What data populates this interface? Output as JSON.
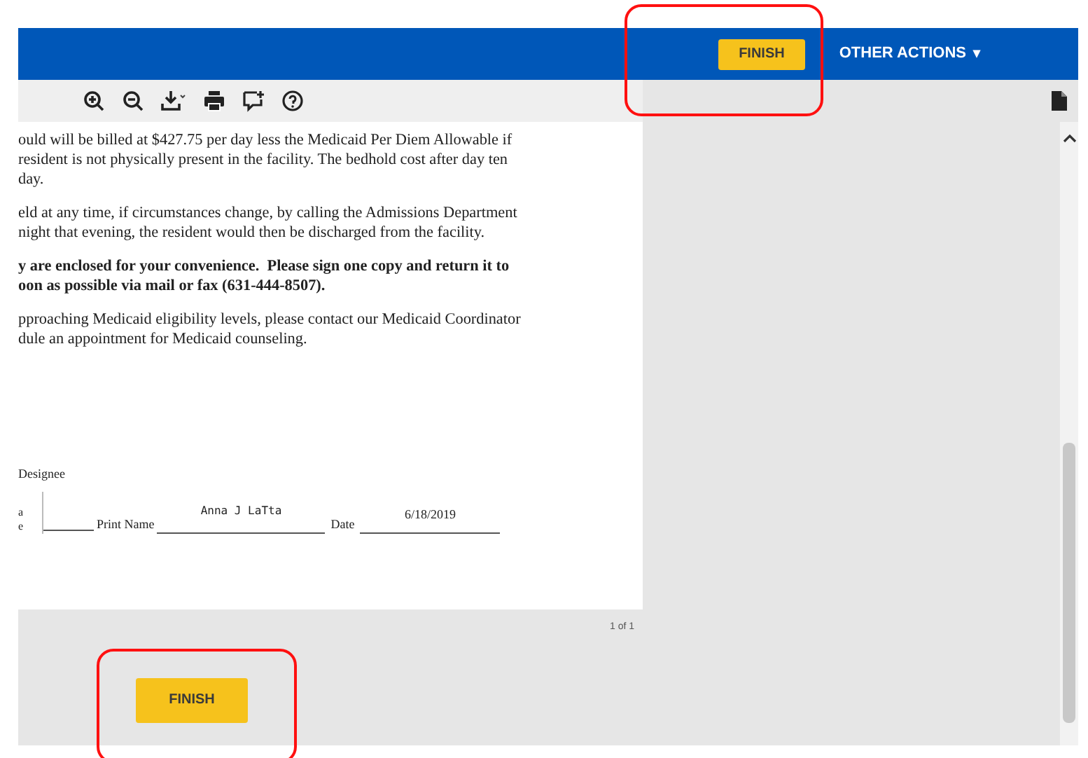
{
  "header": {
    "finish_button": "FINISH",
    "other_actions": {
      "label": "OTHER ACTIONS",
      "caret": "▾"
    }
  },
  "document": {
    "paragraphs": [
      {
        "bold": false,
        "lines": [
          "ould will be billed at $427.75 per day less the Medicaid Per Diem Allowable if",
          "resident is not physically present in the facility. The bedhold cost after day ten",
          "day."
        ]
      },
      {
        "bold": false,
        "lines": [
          "eld at any time, if circumstances change, by calling the Admissions Department",
          "night that evening, the resident would then be discharged from the facility."
        ]
      },
      {
        "bold": true,
        "lines": [
          "y are enclosed for your convenience.  Please sign one copy and return it to",
          "oon as possible via mail or fax (631-444-8507)."
        ]
      },
      {
        "bold": false,
        "lines": [
          "pproaching Medicaid eligibility levels, please contact our Medicaid Coordinator",
          "dule an appointment for Medicaid counseling."
        ]
      }
    ],
    "designee_label": "Designee",
    "signature_fragment": [
      "a",
      "e"
    ],
    "print_name_label": "Print Name",
    "print_name_value": "Anna J LaTta",
    "date_label": "Date",
    "date_value": "6/18/2019",
    "page_indicator": "1 of 1"
  },
  "footer": {
    "finish_button": "FINISH"
  }
}
